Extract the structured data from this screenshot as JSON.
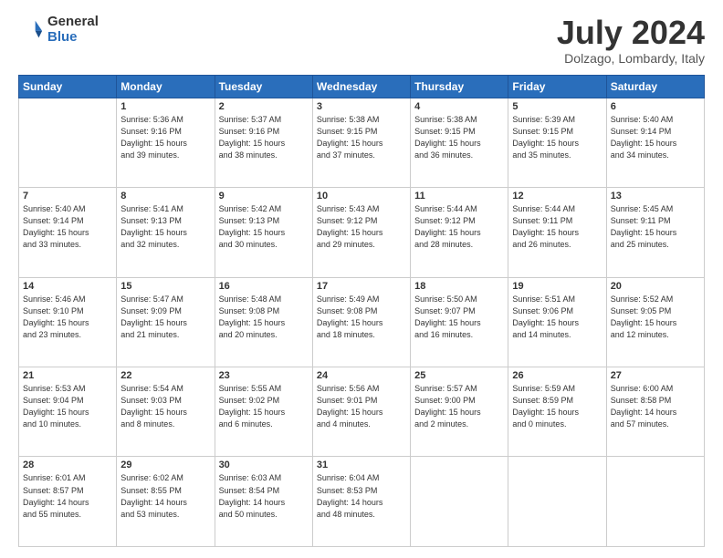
{
  "header": {
    "logo_general": "General",
    "logo_blue": "Blue",
    "month_year": "July 2024",
    "location": "Dolzago, Lombardy, Italy"
  },
  "weekdays": [
    "Sunday",
    "Monday",
    "Tuesday",
    "Wednesday",
    "Thursday",
    "Friday",
    "Saturday"
  ],
  "weeks": [
    [
      {
        "day": "",
        "info": ""
      },
      {
        "day": "1",
        "info": "Sunrise: 5:36 AM\nSunset: 9:16 PM\nDaylight: 15 hours\nand 39 minutes."
      },
      {
        "day": "2",
        "info": "Sunrise: 5:37 AM\nSunset: 9:16 PM\nDaylight: 15 hours\nand 38 minutes."
      },
      {
        "day": "3",
        "info": "Sunrise: 5:38 AM\nSunset: 9:15 PM\nDaylight: 15 hours\nand 37 minutes."
      },
      {
        "day": "4",
        "info": "Sunrise: 5:38 AM\nSunset: 9:15 PM\nDaylight: 15 hours\nand 36 minutes."
      },
      {
        "day": "5",
        "info": "Sunrise: 5:39 AM\nSunset: 9:15 PM\nDaylight: 15 hours\nand 35 minutes."
      },
      {
        "day": "6",
        "info": "Sunrise: 5:40 AM\nSunset: 9:14 PM\nDaylight: 15 hours\nand 34 minutes."
      }
    ],
    [
      {
        "day": "7",
        "info": "Sunrise: 5:40 AM\nSunset: 9:14 PM\nDaylight: 15 hours\nand 33 minutes."
      },
      {
        "day": "8",
        "info": "Sunrise: 5:41 AM\nSunset: 9:13 PM\nDaylight: 15 hours\nand 32 minutes."
      },
      {
        "day": "9",
        "info": "Sunrise: 5:42 AM\nSunset: 9:13 PM\nDaylight: 15 hours\nand 30 minutes."
      },
      {
        "day": "10",
        "info": "Sunrise: 5:43 AM\nSunset: 9:12 PM\nDaylight: 15 hours\nand 29 minutes."
      },
      {
        "day": "11",
        "info": "Sunrise: 5:44 AM\nSunset: 9:12 PM\nDaylight: 15 hours\nand 28 minutes."
      },
      {
        "day": "12",
        "info": "Sunrise: 5:44 AM\nSunset: 9:11 PM\nDaylight: 15 hours\nand 26 minutes."
      },
      {
        "day": "13",
        "info": "Sunrise: 5:45 AM\nSunset: 9:11 PM\nDaylight: 15 hours\nand 25 minutes."
      }
    ],
    [
      {
        "day": "14",
        "info": "Sunrise: 5:46 AM\nSunset: 9:10 PM\nDaylight: 15 hours\nand 23 minutes."
      },
      {
        "day": "15",
        "info": "Sunrise: 5:47 AM\nSunset: 9:09 PM\nDaylight: 15 hours\nand 21 minutes."
      },
      {
        "day": "16",
        "info": "Sunrise: 5:48 AM\nSunset: 9:08 PM\nDaylight: 15 hours\nand 20 minutes."
      },
      {
        "day": "17",
        "info": "Sunrise: 5:49 AM\nSunset: 9:08 PM\nDaylight: 15 hours\nand 18 minutes."
      },
      {
        "day": "18",
        "info": "Sunrise: 5:50 AM\nSunset: 9:07 PM\nDaylight: 15 hours\nand 16 minutes."
      },
      {
        "day": "19",
        "info": "Sunrise: 5:51 AM\nSunset: 9:06 PM\nDaylight: 15 hours\nand 14 minutes."
      },
      {
        "day": "20",
        "info": "Sunrise: 5:52 AM\nSunset: 9:05 PM\nDaylight: 15 hours\nand 12 minutes."
      }
    ],
    [
      {
        "day": "21",
        "info": "Sunrise: 5:53 AM\nSunset: 9:04 PM\nDaylight: 15 hours\nand 10 minutes."
      },
      {
        "day": "22",
        "info": "Sunrise: 5:54 AM\nSunset: 9:03 PM\nDaylight: 15 hours\nand 8 minutes."
      },
      {
        "day": "23",
        "info": "Sunrise: 5:55 AM\nSunset: 9:02 PM\nDaylight: 15 hours\nand 6 minutes."
      },
      {
        "day": "24",
        "info": "Sunrise: 5:56 AM\nSunset: 9:01 PM\nDaylight: 15 hours\nand 4 minutes."
      },
      {
        "day": "25",
        "info": "Sunrise: 5:57 AM\nSunset: 9:00 PM\nDaylight: 15 hours\nand 2 minutes."
      },
      {
        "day": "26",
        "info": "Sunrise: 5:59 AM\nSunset: 8:59 PM\nDaylight: 15 hours\nand 0 minutes."
      },
      {
        "day": "27",
        "info": "Sunrise: 6:00 AM\nSunset: 8:58 PM\nDaylight: 14 hours\nand 57 minutes."
      }
    ],
    [
      {
        "day": "28",
        "info": "Sunrise: 6:01 AM\nSunset: 8:57 PM\nDaylight: 14 hours\nand 55 minutes."
      },
      {
        "day": "29",
        "info": "Sunrise: 6:02 AM\nSunset: 8:55 PM\nDaylight: 14 hours\nand 53 minutes."
      },
      {
        "day": "30",
        "info": "Sunrise: 6:03 AM\nSunset: 8:54 PM\nDaylight: 14 hours\nand 50 minutes."
      },
      {
        "day": "31",
        "info": "Sunrise: 6:04 AM\nSunset: 8:53 PM\nDaylight: 14 hours\nand 48 minutes."
      },
      {
        "day": "",
        "info": ""
      },
      {
        "day": "",
        "info": ""
      },
      {
        "day": "",
        "info": ""
      }
    ]
  ]
}
